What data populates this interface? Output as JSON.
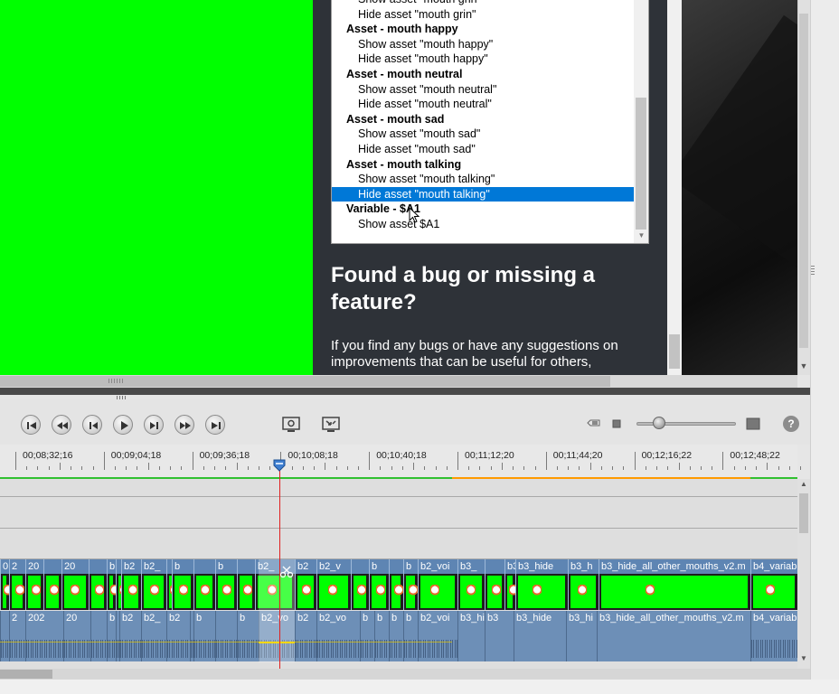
{
  "listbox": {
    "items": [
      {
        "kind": "opt",
        "text": "Show asset \"mouth grin\""
      },
      {
        "kind": "opt",
        "text": "Hide asset \"mouth grin\""
      },
      {
        "kind": "grp",
        "text": "Asset - mouth happy"
      },
      {
        "kind": "opt",
        "text": "Show asset \"mouth happy\""
      },
      {
        "kind": "opt",
        "text": "Hide asset \"mouth happy\""
      },
      {
        "kind": "grp",
        "text": "Asset - mouth neutral"
      },
      {
        "kind": "opt",
        "text": "Show asset \"mouth neutral\""
      },
      {
        "kind": "opt",
        "text": "Hide asset \"mouth neutral\""
      },
      {
        "kind": "grp",
        "text": "Asset - mouth sad"
      },
      {
        "kind": "opt",
        "text": "Show asset \"mouth sad\""
      },
      {
        "kind": "opt",
        "text": "Hide asset \"mouth sad\""
      },
      {
        "kind": "grp",
        "text": "Asset - mouth talking"
      },
      {
        "kind": "opt",
        "text": "Show asset \"mouth talking\""
      },
      {
        "kind": "opt",
        "text": "Hide asset \"mouth talking\"",
        "selected": true
      },
      {
        "kind": "grp",
        "text": "Variable - $A1"
      },
      {
        "kind": "opt",
        "text": "Show asset $A1"
      }
    ],
    "selected_color": "#0078d7"
  },
  "help_section": {
    "heading": "Found a bug or missing a feature?",
    "body": "If you find any bugs or have any suggestions on improvements that can be useful for others,"
  },
  "transport": {
    "buttons": [
      "go-to-start-icon",
      "previous-marker-icon",
      "previous-frame-icon",
      "play-icon",
      "next-frame-icon",
      "next-marker-icon",
      "go-to-end-icon"
    ],
    "help_label": "?"
  },
  "ruler": {
    "ticks": [
      "00;08;32;16",
      "00;09;04;18",
      "00;09;36;18",
      "00;10;08;18",
      "00;10;40;18",
      "00;11;12;20",
      "00;11;44;20",
      "00;12;16;22",
      "00;12;48;22"
    ]
  },
  "video_clips": [
    "0",
    "2",
    "20",
    "",
    "20",
    "",
    "b",
    "",
    "b2",
    "b2_",
    "",
    "b",
    "",
    "b",
    "",
    "b2_",
    "b2",
    "b2_v",
    "",
    "b",
    "",
    "b",
    "b2_voi",
    "b3_",
    "",
    "b3",
    "b3_hide",
    "b3_h",
    "b3_hide_all_other_mouths_v2.m",
    "b4_variab"
  ],
  "audio_clips": [
    "",
    "2",
    "202",
    "20",
    "",
    "b",
    "",
    "b2",
    "b2_",
    "b2",
    "",
    "b",
    "",
    "b",
    "b2_vo",
    "b2",
    "b2_vo",
    "b",
    "b",
    "b",
    "b",
    "b2_voi",
    "b3_hi",
    "b3",
    "b3_hide",
    "b3_hi",
    "b3_hide_all_other_mouths_v2.m",
    "b4_variab"
  ],
  "colors": {
    "preview_green": "#00ff00",
    "page_dark": "#2e3238",
    "playhead": "#e02020",
    "clip_header": "#5e85b3"
  }
}
